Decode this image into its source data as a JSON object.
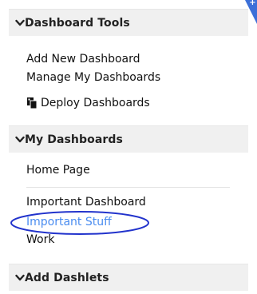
{
  "colors": {
    "header_bg": "#f0f0f0",
    "link_text": "#111111",
    "highlight_link": "#4a8cf0",
    "annotation_circle": "#2233cc",
    "corner_badge": "#3c6fd8"
  },
  "corner_badge": {
    "symbol": "+"
  },
  "sections": {
    "dashboard_tools": {
      "title": "Dashboard Tools",
      "icon": "chevron-down-icon",
      "items": {
        "add_new": "Add New Dashboard",
        "manage": "Manage My Dashboards",
        "deploy": "Deploy Dashboards",
        "deploy_icon": "copy-document-icon"
      }
    },
    "my_dashboards": {
      "title": "My Dashboards",
      "icon": "chevron-down-icon",
      "items": {
        "home": "Home Page",
        "important_dashboard": "Important Dashboard",
        "important_stuff": "Important Stuff",
        "work": "Work"
      }
    },
    "add_dashlets": {
      "title": "Add Dashlets",
      "icon": "chevron-down-icon"
    }
  }
}
